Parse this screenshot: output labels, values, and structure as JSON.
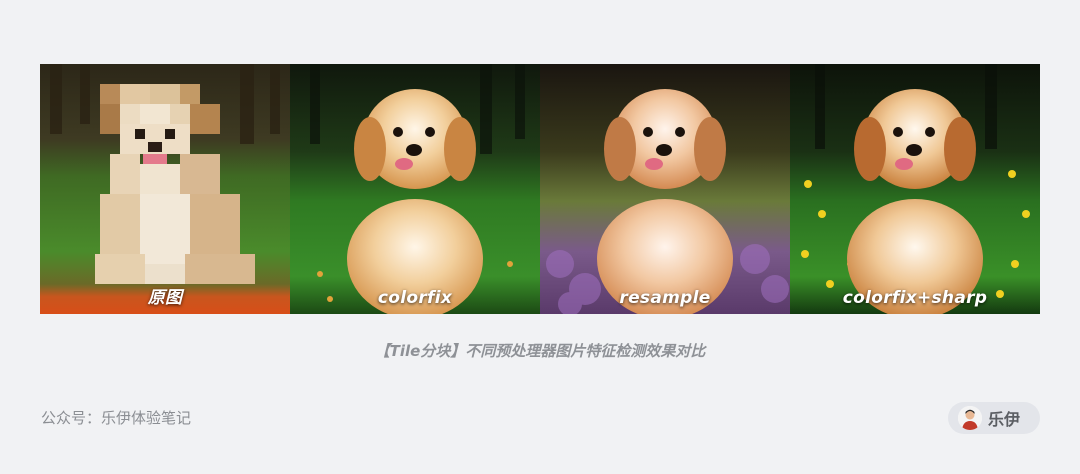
{
  "panels": [
    {
      "label": "原图",
      "variant": "pixelated"
    },
    {
      "label": "colorfix",
      "variant": "green"
    },
    {
      "label": "resample",
      "variant": "purple"
    },
    {
      "label": "colorfix+sharp",
      "variant": "yellow"
    }
  ],
  "caption": "【Tile分块】不同预处理器图片特征检测效果对比",
  "footer": {
    "source": "公众号：乐伊体验笔记",
    "author": "乐伊",
    "avatar_icon": "person-avatar-icon"
  },
  "colors": {
    "background": "#f1f2f4",
    "caption": "#8e9196",
    "chip": "#e3e5ea"
  }
}
